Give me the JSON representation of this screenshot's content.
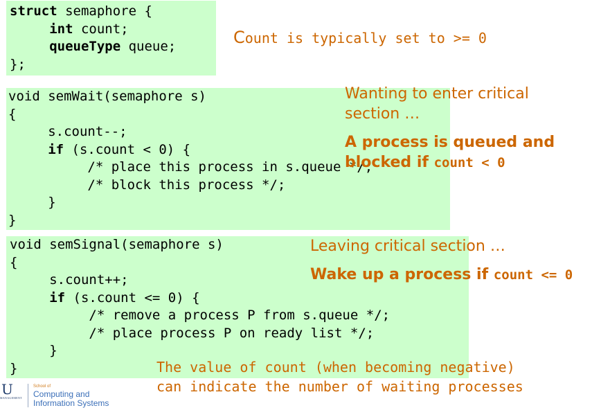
{
  "struct_block": {
    "line1_kw": "struct",
    "line1_rest": " semaphore {",
    "line2_indent": "     ",
    "line2_kw": "int",
    "line2_rest": " count;",
    "line3_indent": "     ",
    "line3_kw": "queueType",
    "line3_rest": " queue;",
    "line4": "};"
  },
  "struct_note": {
    "first_letter": "C",
    "rest": "ount is typically set to >= 0"
  },
  "semwait_block": {
    "line1": "void semWait(semaphore s)",
    "line2": "{",
    "line3": "     s.count--;",
    "line4_indent": "     ",
    "line4_kw": "if",
    "line4_rest": " (s.count < 0) {",
    "line5": "          /* place this process in s.queue */;",
    "line6": "          /* block this process */;",
    "line7": "     }",
    "line8": "}"
  },
  "semwait_note": {
    "text": "Wanting to enter critical section …",
    "bold_text": "A process is queued and blocked if ",
    "bold_code": "count < 0"
  },
  "semsignal_block": {
    "line1": "void semSignal(semaphore s)",
    "line2": "{",
    "line3": "     s.count++;",
    "line4_indent": "     ",
    "line4_kw": "if",
    "line4_rest": " (s.count <= 0) {",
    "line5": "          /* remove a process P from s.queue */;",
    "line6": "          /* place process P on ready list */;",
    "line7": "     }",
    "line8": "}"
  },
  "semsignal_note": {
    "text": "Leaving critical section …",
    "bold_text": "Wake up a process if ",
    "bold_code": "count <= 0"
  },
  "bottom_note": {
    "line1": "The value of count (when becoming negative)",
    "line2": "can indicate the number of waiting processes"
  },
  "footer": {
    "logo_letter": "U",
    "logo_tagline": "MANAGEMENT",
    "school_of": "School of",
    "school_name_1": "Computing and",
    "school_name_2": "Information Systems"
  }
}
